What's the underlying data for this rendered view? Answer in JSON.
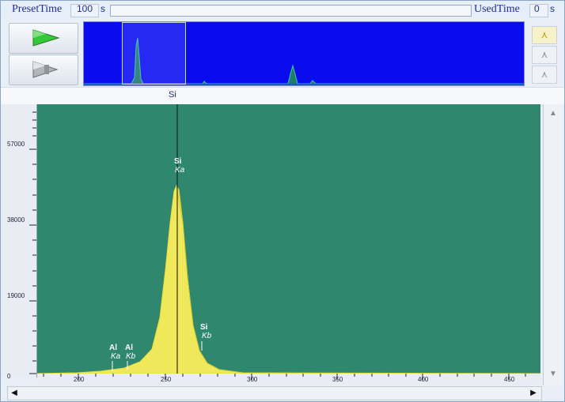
{
  "top": {
    "preset_label": "PresetTime",
    "preset_value": "100",
    "preset_unit": "s",
    "used_label": "UsedTime",
    "used_value": "0",
    "used_unit": "s",
    "progress_fraction": 0.0
  },
  "left_buttons": [
    {
      "name": "start-acquisition-button",
      "icon": "green-arrow-icon"
    },
    {
      "name": "stop-acquisition-button",
      "icon": "gray-arrow-icon"
    }
  ],
  "peak_buttons": [
    {
      "icon": "peak-shape-icon",
      "glyph": "⋏",
      "active": true
    },
    {
      "icon": "peak-shape-icon",
      "glyph": "⋏",
      "active": false
    },
    {
      "icon": "peak-shape-icon",
      "glyph": "⋏",
      "active": false
    }
  ],
  "marker": {
    "label": "Si"
  },
  "spectrum": {
    "y_ticks": [
      "57000",
      "38000",
      "19000",
      "0"
    ],
    "x_ticks": [
      "200",
      "250",
      "300",
      "350",
      "400",
      "450"
    ],
    "peaks": [
      {
        "element": "Al",
        "line": "Ka"
      },
      {
        "element": "Al",
        "line": "Kb"
      },
      {
        "element": "Si",
        "line": "Ka"
      },
      {
        "element": "Si",
        "line": "Kb"
      }
    ]
  },
  "colors": {
    "plot_bg": "#2f876d",
    "peak_fill": "#f0e85b",
    "overview_bg": "#0a0cf0"
  },
  "scrollbars": {
    "h_left": "◀",
    "h_right": "▶",
    "v_up": "▲",
    "v_down": "▼"
  }
}
